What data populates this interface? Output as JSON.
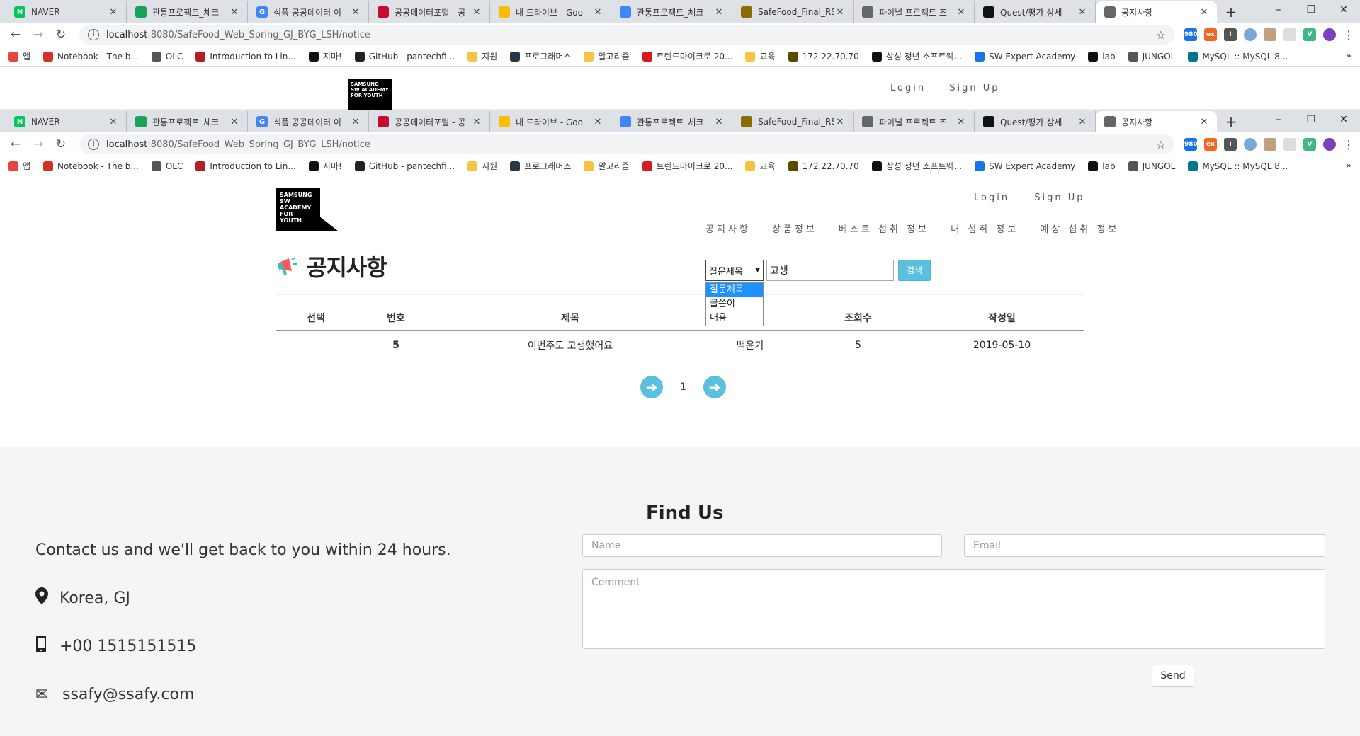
{
  "browser": {
    "tabs": [
      {
        "label": "NAVER",
        "icon": "naver-icon",
        "color": "#03c75a",
        "glyph": "N"
      },
      {
        "label": "관통프로젝트_체크",
        "icon": "sheets-icon",
        "color": "#19a35a",
        "glyph": ""
      },
      {
        "label": "식품 공공데이터 이",
        "icon": "google-icon",
        "color": "#4285f4",
        "glyph": "G"
      },
      {
        "label": "공공데이터포털 - 공",
        "icon": "korea-icon",
        "color": "#c60c30",
        "glyph": ""
      },
      {
        "label": "내 드라이브 - Goo",
        "icon": "drive-icon",
        "color": "#fbbc04",
        "glyph": ""
      },
      {
        "label": "관통프로젝트_체크",
        "icon": "docs-icon",
        "color": "#4285f4",
        "glyph": ""
      },
      {
        "label": "SafeFood_Final_RS",
        "icon": "folder-icon",
        "color": "#8a6d00",
        "glyph": ""
      },
      {
        "label": "파이널 프로젝트 조",
        "icon": "globe-icon",
        "color": "#666666",
        "glyph": ""
      },
      {
        "label": "Quest/평가 상세",
        "icon": "swea-icon",
        "color": "#111111",
        "glyph": ""
      },
      {
        "label": "공지사항",
        "icon": "globe-icon",
        "color": "#666666",
        "glyph": "",
        "active": true
      }
    ],
    "url_host": "localhost",
    "url_path": ":8080/SafeFood_Web_Spring_GJ_BYG_LSH/notice",
    "bookmarks": [
      {
        "label": "앱",
        "color": "#e8453c"
      },
      {
        "label": "Notebook - The b...",
        "color": "#d93025"
      },
      {
        "label": "OLC",
        "color": "#555555"
      },
      {
        "label": "Introduction to Lin...",
        "color": "#b51f24"
      },
      {
        "label": "지마!",
        "color": "#111111"
      },
      {
        "label": "GitHub - pantechfi...",
        "color": "#222222"
      },
      {
        "label": "지원",
        "color": "#f6c342"
      },
      {
        "label": "프로그래머스",
        "color": "#263747"
      },
      {
        "label": "알고리즘",
        "color": "#f6c342"
      },
      {
        "label": "트렌드마이크로 20...",
        "color": "#d71920"
      },
      {
        "label": "교육",
        "color": "#f6c342"
      },
      {
        "label": "172.22.70.70",
        "color": "#5a4a00"
      },
      {
        "label": "삼성 청년 소프트웨...",
        "color": "#111111"
      },
      {
        "label": "SW Expert Academy",
        "color": "#1a73e8"
      },
      {
        "label": "lab",
        "color": "#111111"
      },
      {
        "label": "JUNGOL",
        "color": "#555555"
      },
      {
        "label": "MySQL :: MySQL 8...",
        "color": "#00758f"
      }
    ]
  },
  "ghost_header": {
    "logo": "SAMSUNG SW ACADEMY FOR YOUTH",
    "login": "Login",
    "signup": "Sign Up"
  },
  "header": {
    "logo": "SAMSUNG SW ACADEMY FOR YOUTH",
    "login": "Login",
    "signup": "Sign Up",
    "nav": [
      "공지사항",
      "상품정보",
      "베스트 섭취 정보",
      "내 섭취 정보",
      "예상 섭취 정보"
    ]
  },
  "notice": {
    "title": "공지사항",
    "search": {
      "selected": "질문제목",
      "options": [
        "질문제목",
        "글쓴이",
        "내용"
      ],
      "query": "고생",
      "button": "검색"
    },
    "columns": [
      "선택",
      "번호",
      "제목",
      "",
      "조회수",
      "작성일"
    ],
    "rows": [
      {
        "select": "",
        "no": "5",
        "title": "이번주도 고생했어요",
        "writer": "백윤기",
        "views": "5",
        "date": "2019-05-10"
      }
    ],
    "page": "1"
  },
  "footer": {
    "lead": "Contact us and we'll get back to you within 24 hours.",
    "location": "Korea, GJ",
    "phone": "+00 1515151515",
    "email": "ssafy@ssafy.com",
    "find_us": "Find Us",
    "name_placeholder": "Name",
    "email_placeholder": "Email",
    "comment_placeholder": "Comment",
    "send": "Send"
  }
}
